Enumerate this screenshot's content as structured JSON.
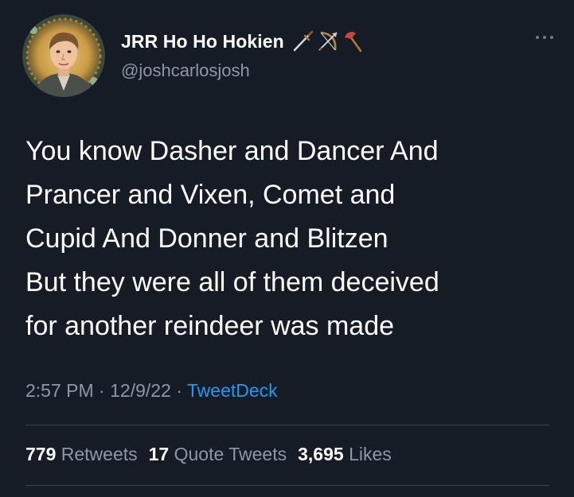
{
  "user": {
    "display_name": "JRR Ho Ho Hokien",
    "handle": "@joshcarlosjosh",
    "name_emojis": [
      "dagger-icon",
      "bow-and-arrow-icon",
      "axe-icon"
    ]
  },
  "tweet": {
    "lines": [
      "You know Dasher and Dancer And",
      "Prancer and Vixen, Comet and",
      "Cupid And Donner and Blitzen",
      "But they were all of them deceived",
      "for another reindeer was made"
    ]
  },
  "meta": {
    "time": "2:57 PM",
    "sep1": " · ",
    "date": "12/9/22",
    "sep2": " · ",
    "source": "TweetDeck"
  },
  "stats": {
    "retweets_count": "779",
    "retweets_label": "Retweets",
    "quotes_count": "17",
    "quotes_label": "Quote Tweets",
    "likes_count": "3,695",
    "likes_label": "Likes"
  },
  "colors": {
    "background": "#161c26",
    "text": "#ffffff",
    "secondary": "#8b98a5",
    "link": "#1d9bf0",
    "divider": "#38444d"
  }
}
